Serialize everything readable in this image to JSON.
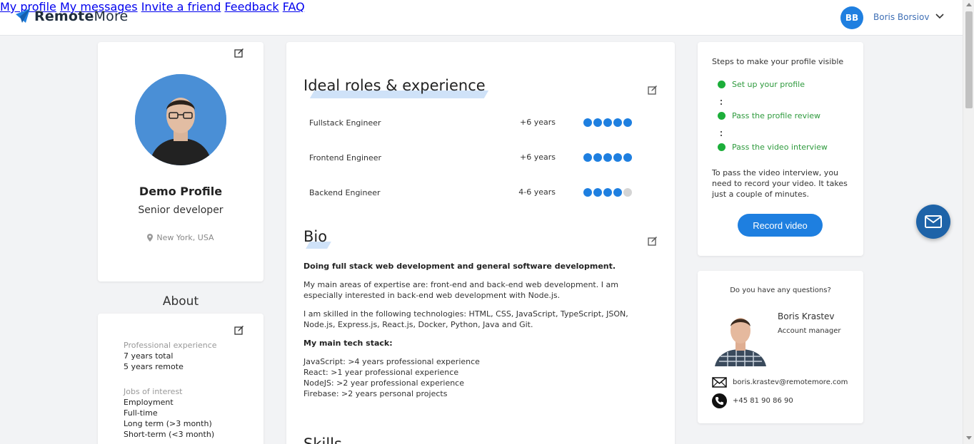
{
  "brand": {
    "name_bold": "Remote",
    "name_light": "More",
    "accent": "#1e7fe0"
  },
  "nav": {
    "items": [
      "My profile",
      "My messages",
      "Invite a friend",
      "Feedback",
      "FAQ"
    ],
    "user_initials": "BB",
    "user_name": "Boris Borsiov"
  },
  "profile": {
    "name": "Demo Profile",
    "title": "Senior developer",
    "location": "New York, USA"
  },
  "about": {
    "title": "About",
    "sections": [
      {
        "label": "Professional experience",
        "values": [
          "7 years total",
          "5 years remote"
        ]
      },
      {
        "label": "Jobs of interest",
        "values": [
          "Employment",
          "Full-time",
          "Long term (>3 month)",
          "Short-term (<3 month)"
        ]
      }
    ]
  },
  "roles": {
    "title": "Ideal roles & experience",
    "items": [
      {
        "name": "Fullstack Engineer",
        "years": "+6 years",
        "level": 5,
        "max": 5
      },
      {
        "name": "Frontend Engineer",
        "years": "+6 years",
        "level": 5,
        "max": 5
      },
      {
        "name": "Backend Engineer",
        "years": "4-6 years",
        "level": 4,
        "max": 5
      }
    ]
  },
  "bio": {
    "title": "Bio",
    "headline": "Doing full stack web development and general software development.",
    "p1": "My main areas of expertise are: front-end and back-end web development. I am especially interested in back-end web development with Node.js.",
    "p2": "I am skilled in the following technologies: HTML, CSS, JavaScript, TypeScript, JSON, Node.js, Express.js, React.js, Docker, Python, Java and Git.",
    "stack_title": "My main tech stack:",
    "stack": [
      "JavaScript: >4 years professional experience",
      "React: >1 year professional experience",
      "NodeJS: >2 year professional experience",
      "Firebase: >2 years personal projects"
    ]
  },
  "skills": {
    "title": "Skills"
  },
  "steps": {
    "heading": "Steps to make your profile visible",
    "items": [
      "Set up your profile",
      "Pass the profile review",
      "Pass the video interview"
    ],
    "note": "To pass the video interview, you need to record your video. It takes just a couple of minutes.",
    "button": "Record video"
  },
  "contact": {
    "question": "Do you have any questions?",
    "name": "Boris Krastev",
    "role": "Account manager",
    "email": "boris.krastev@remotemore.com",
    "phone": "+45 81 90 86 90"
  }
}
